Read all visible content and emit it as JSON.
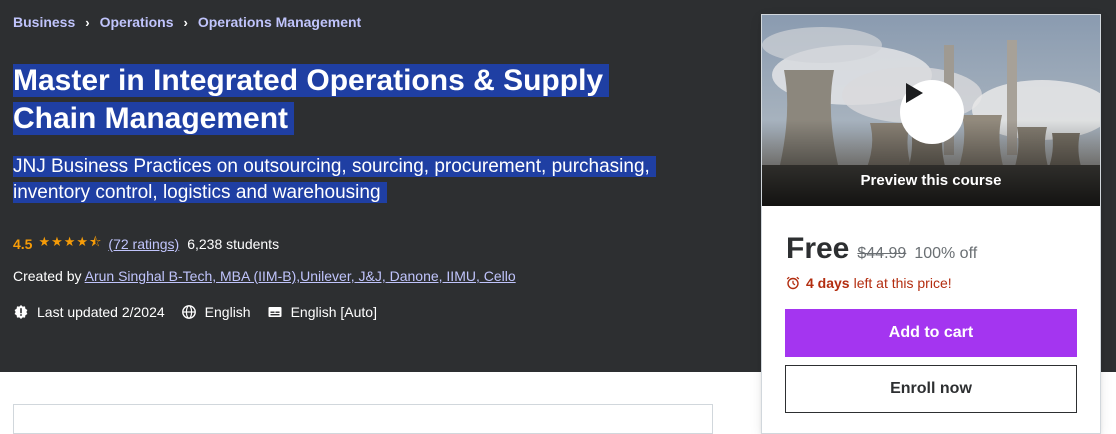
{
  "breadcrumb": [
    "Business",
    "Operations",
    "Operations Management"
  ],
  "breadcrumb_sep": "›",
  "course": {
    "title": "Master in Integrated Operations & Supply Chain Management",
    "subtitle": "JNJ Business Practices on outsourcing, sourcing, procurement, purchasing, inventory control, logistics and warehousing",
    "rating": "4.5",
    "stars": "★★★★⯪",
    "ratings_count": "(72 ratings)",
    "students": "6,238 students",
    "created_by_label": "Created by",
    "instructors": "Arun Singhal B-Tech, MBA (IIM-B),Unilever, J&J, Danone, IIMU, Cello",
    "last_updated": "Last updated 2/2024",
    "language": "English",
    "captions": "English [Auto]"
  },
  "card": {
    "preview_label": "Preview this course",
    "price": "Free",
    "original_price": "$44.99",
    "discount": "100% off",
    "timer_bold": "4 days",
    "timer_rest": "left at this price!",
    "add_to_cart": "Add to cart",
    "enroll_now": "Enroll now"
  },
  "colors": {
    "hero_bg": "#2d2f31",
    "link": "#c0c4fc",
    "star": "#f69c08",
    "cart_button": "#a435f0",
    "timer": "#b32d0f"
  },
  "icons": [
    "chevron-right-icon",
    "star-icon",
    "update-alert-icon",
    "globe-icon",
    "captions-icon",
    "play-icon",
    "alarm-clock-icon"
  ]
}
